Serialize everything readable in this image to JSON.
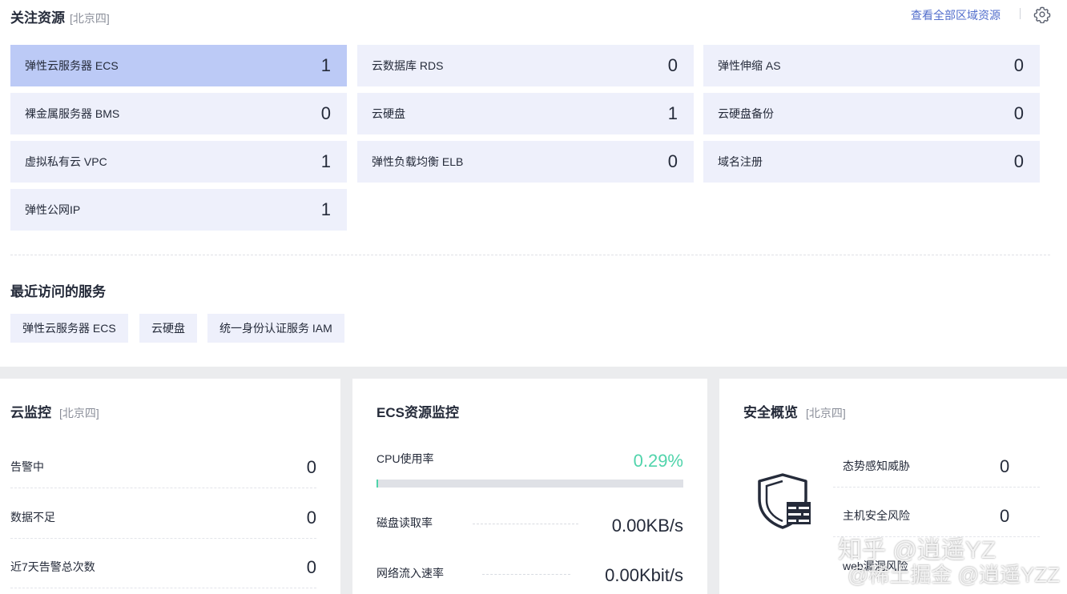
{
  "followed": {
    "title": "关注资源",
    "region": "[北京四]",
    "view_all": "查看全部区域资源",
    "cards": [
      {
        "name": "弹性云服务器 ECS",
        "count": "1"
      },
      {
        "name": "云数据库 RDS",
        "count": "0"
      },
      {
        "name": "弹性伸缩 AS",
        "count": "0"
      },
      {
        "name": "裸金属服务器 BMS",
        "count": "0"
      },
      {
        "name": "云硬盘",
        "count": "1"
      },
      {
        "name": "云硬盘备份",
        "count": "0"
      },
      {
        "name": "虚拟私有云 VPC",
        "count": "1"
      },
      {
        "name": "弹性负载均衡 ELB",
        "count": "0"
      },
      {
        "name": "域名注册",
        "count": "0"
      },
      {
        "name": "弹性公网IP",
        "count": "1"
      }
    ]
  },
  "recent": {
    "title": "最近访问的服务",
    "items": [
      "弹性云服务器 ECS",
      "云硬盘",
      "统一身份认证服务 IAM"
    ]
  },
  "cloud_monitor": {
    "title": "云监控",
    "region": "[北京四]",
    "rows": [
      {
        "label": "告警中",
        "value": "0"
      },
      {
        "label": "数据不足",
        "value": "0"
      },
      {
        "label": "近7天告警总次数",
        "value": "0"
      }
    ]
  },
  "ecs_monitor": {
    "title": "ECS资源监控",
    "cpu_label": "CPU使用率",
    "cpu_value": "0.29%",
    "cpu_fraction": 0.0029,
    "cpu_color": "#50d4ab",
    "disk_label": "磁盘读取率",
    "disk_value": "0.00KB/s",
    "net_label": "网络流入速率",
    "net_value": "0.00Kbit/s"
  },
  "security": {
    "title": "安全概览",
    "region": "[北京四]",
    "icon": "shield-firewall-icon",
    "rows": [
      {
        "label": "态势感知威胁",
        "value": "0"
      },
      {
        "label": "主机安全风险",
        "value": "0"
      },
      {
        "label": "web漏洞风险",
        "value": ""
      }
    ]
  },
  "watermarks": [
    "知乎 @逍遥YZ",
    "@稀土掘金 @逍遥YZZ"
  ],
  "colors": {
    "accent": "#526ecc",
    "card_bg": "#eef0fb",
    "card_active": "#bccaf6"
  }
}
